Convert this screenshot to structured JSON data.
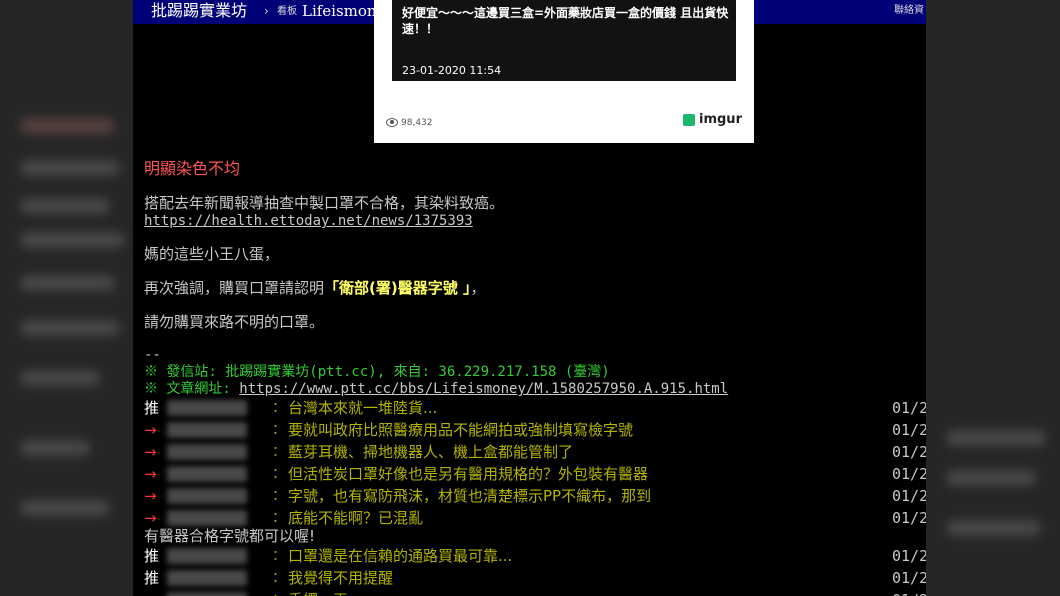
{
  "header": {
    "board_title": "批踢踢實業坊",
    "separator": "›",
    "board_label": "看板",
    "board_name": "Lifeismoney",
    "contact": "聯絡資"
  },
  "image_card": {
    "message": "好便宜～～～這邊買三盒=外面藥妝店買一盒的價錢 且出貨快速！！",
    "timestamp": "23-01-2020 11:54",
    "views": "98,432",
    "logo": "imgur"
  },
  "article": {
    "red_note": "明顯染色不均",
    "para1": "搭配去年新聞報導抽查中製口罩不合格，其染料致癌。",
    "news_link": "https://health.ettoday.net/news/1375393",
    "para2": "媽的這些小王八蛋，",
    "para3_pre": "再次強調，購買口罩請認明",
    "para3_hl": "「衛部(署)醫器字號 」",
    "para3_post": "，",
    "para4": "請勿購買來路不明的口罩。",
    "signature_sep": "--",
    "origin": "※ 發信站: 批踢踢實業坊(ptt.cc), 來自: 36.229.217.158 (臺灣)",
    "url_label": "※ 文章網址: ",
    "url": "https://www.ptt.cc/bbs/Lifeismoney/M.1580257950.A.915.html"
  },
  "pushes": [
    {
      "tag": "推",
      "type": "push",
      "colon": "：",
      "text": "台灣本來就一堆陸貨...",
      "date": "01/2"
    },
    {
      "tag": "→",
      "type": "arrow",
      "colon": "：",
      "text": "要就叫政府比照醫療用品不能網拍或強制填寫檢字號",
      "date": "01/2"
    },
    {
      "tag": "→",
      "type": "arrow",
      "colon": "：",
      "text": "藍芽耳機、掃地機器人、機上盒都能管制了",
      "date": "01/2"
    },
    {
      "tag": "→",
      "type": "arrow",
      "colon": "：",
      "text": "但活性炭口罩好像也是另有醫用規格的？外包裝有醫器",
      "date": "01/2"
    },
    {
      "tag": "→",
      "type": "arrow",
      "colon": "：",
      "text": "字號，也有寫防飛沫，材質也清楚標示PP不織布，那到",
      "date": "01/2"
    },
    {
      "tag": "→",
      "type": "arrow",
      "colon": "：",
      "text": "底能不能啊？已混亂",
      "date": "01/2"
    }
  ],
  "continuation": "有醫器合格字號都可以喔!",
  "pushes2": [
    {
      "tag": "推",
      "type": "push",
      "colon": "：",
      "text": "口罩還是在信賴的通路買最可靠...",
      "date": "01/2"
    },
    {
      "tag": "推",
      "type": "push",
      "colon": "：",
      "text": "我覺得不用提醒",
      "date": "01/2"
    },
    {
      "tag": "→",
      "type": "arrow",
      "colon": "：",
      "text": "手擇，丟",
      "date": "01/2"
    }
  ]
}
